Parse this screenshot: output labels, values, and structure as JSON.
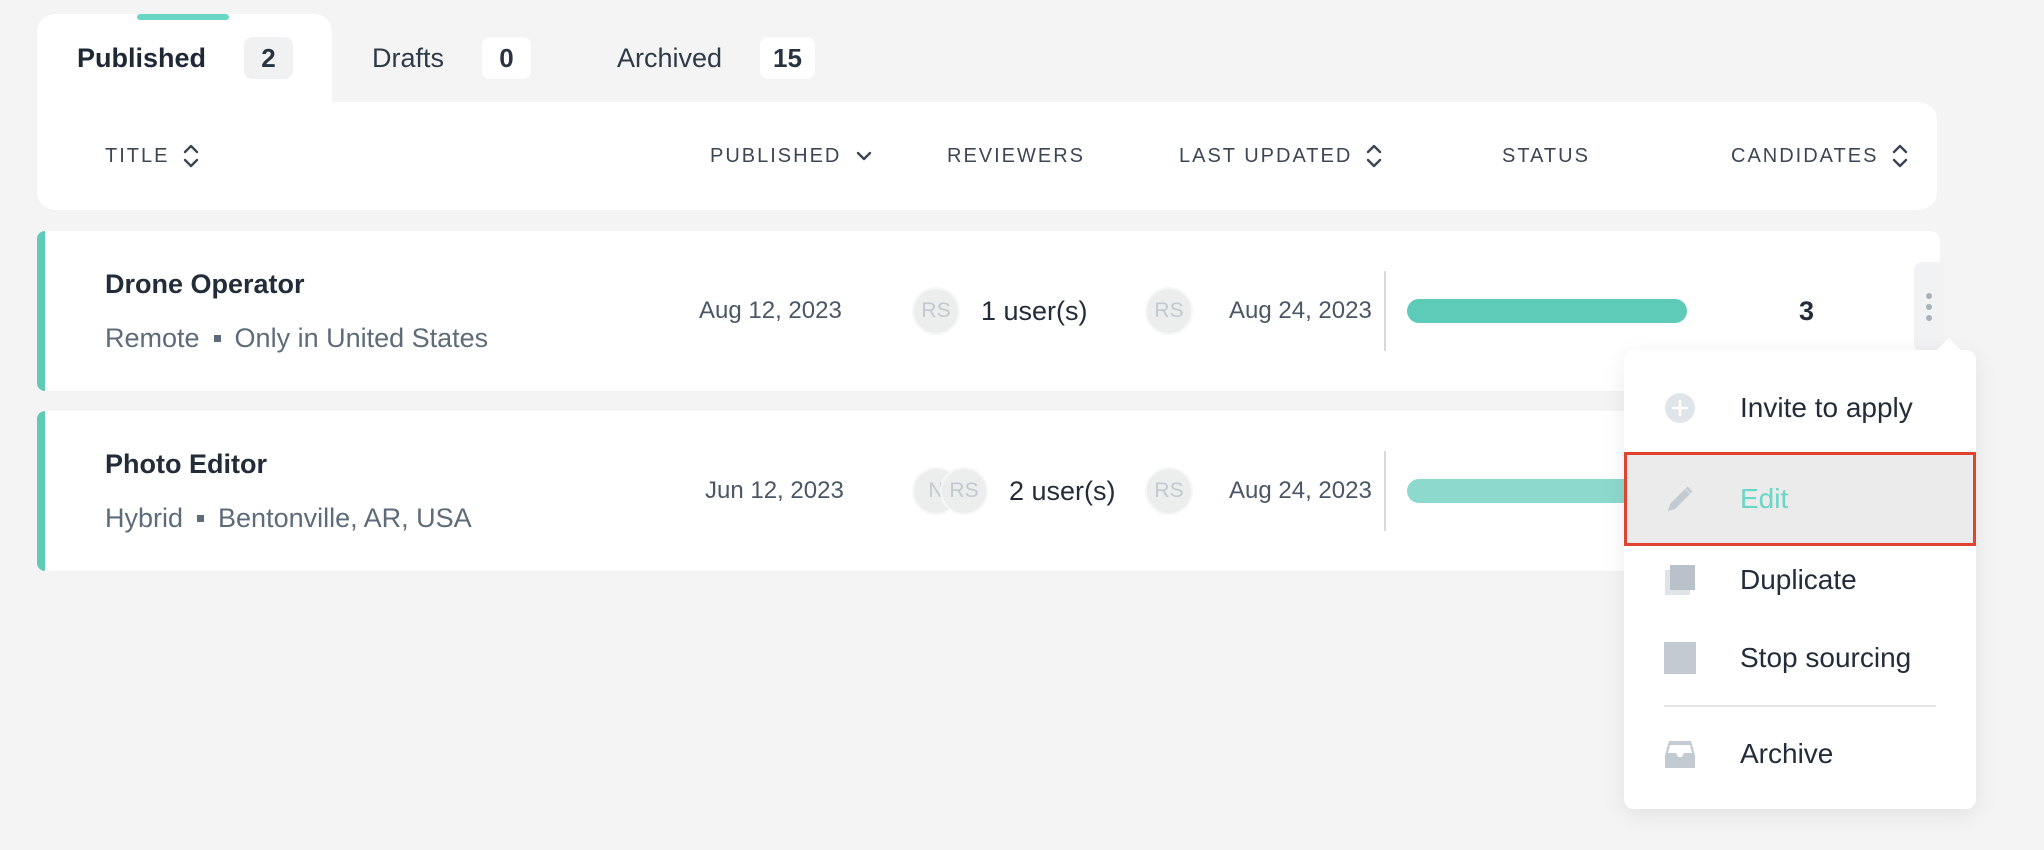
{
  "tabs": [
    {
      "label": "Published",
      "count": "2"
    },
    {
      "label": "Drafts",
      "count": "0"
    },
    {
      "label": "Archived",
      "count": "15"
    }
  ],
  "columns": {
    "title": "TITLE",
    "published": "PUBLISHED",
    "reviewers": "REVIEWERS",
    "last_updated": "LAST UPDATED",
    "status": "STATUS",
    "candidates": "CANDIDATES"
  },
  "rows": [
    {
      "title": "Drone Operator",
      "location_type": "Remote",
      "location": "Only in United States",
      "published": "Aug 12, 2023",
      "reviewer_avatars": [
        "RS"
      ],
      "reviewers": "1 user(s)",
      "updater_avatar": "RS",
      "last_updated": "Aug 24, 2023",
      "status_progress": 1.0,
      "candidates": "3"
    },
    {
      "title": "Photo Editor",
      "location_type": "Hybrid",
      "location": "Bentonville, AR, USA",
      "published": "Jun 12, 2023",
      "reviewer_avatars": [
        "N",
        "RS"
      ],
      "reviewers": "2 user(s)",
      "updater_avatar": "RS",
      "last_updated": "Aug 24, 2023",
      "status_progress": 1.0,
      "candidates": ""
    }
  ],
  "menu": {
    "items": [
      {
        "label": "Invite to apply",
        "icon": "plus-circle-icon"
      },
      {
        "label": "Edit",
        "icon": "pencil-icon"
      },
      {
        "label": "Duplicate",
        "icon": "duplicate-icon"
      },
      {
        "label": "Stop sourcing",
        "icon": "stop-icon"
      },
      {
        "label": "Archive",
        "icon": "inbox-archive-icon"
      }
    ]
  },
  "colors": {
    "accent": "#5ecab8",
    "accent_light": "#8dd9ce",
    "highlight_border": "#e0432f",
    "tab_indicator": "#6ad6c5"
  }
}
